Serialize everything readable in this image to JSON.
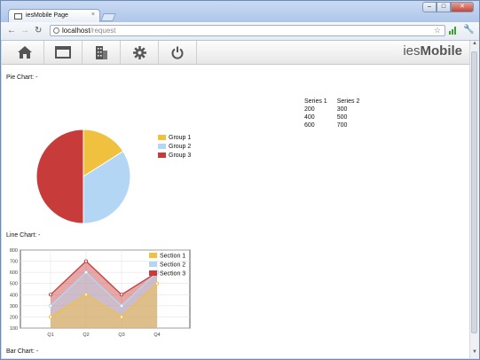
{
  "browser": {
    "tab_title": "iesMobile Page",
    "tab_close": "×",
    "url_host": "localhost",
    "url_path": "/request"
  },
  "app": {
    "brand_prefix": "ies",
    "brand_suffix": "Mobile",
    "nav_icons": [
      "home-icon",
      "window-icon",
      "building-icon",
      "gear-icon",
      "power-icon"
    ]
  },
  "labels": {
    "pie": "Pie Chart: -",
    "line": "Line Chart: -",
    "bar": "Bar Chart: -"
  },
  "series_table": {
    "headers": [
      "Series 1",
      "Series 2"
    ],
    "rows": [
      [
        "200",
        "300"
      ],
      [
        "400",
        "500"
      ],
      [
        "600",
        "700"
      ]
    ]
  },
  "colors": {
    "yellow": "#f0c03f",
    "blue": "#b3d6f5",
    "red": "#c83b3b"
  },
  "chart_data": [
    {
      "type": "pie",
      "labels": [
        "Group 1",
        "Group 2",
        "Group 3"
      ],
      "values": [
        16,
        34,
        50
      ],
      "legend": "right"
    },
    {
      "type": "area",
      "categories": [
        "Q1",
        "Q2",
        "Q3",
        "Q4"
      ],
      "series": [
        {
          "name": "Section 1",
          "values": [
            200,
            400,
            200,
            500
          ]
        },
        {
          "name": "Section 2",
          "values": [
            300,
            600,
            300,
            600
          ]
        },
        {
          "name": "Section 3",
          "values": [
            400,
            700,
            400,
            600
          ]
        }
      ],
      "ylim": [
        100,
        800
      ],
      "yticks": [
        "100",
        "200",
        "300",
        "400",
        "500",
        "600",
        "700",
        "800"
      ],
      "grid": true,
      "legend": "top-right"
    }
  ]
}
